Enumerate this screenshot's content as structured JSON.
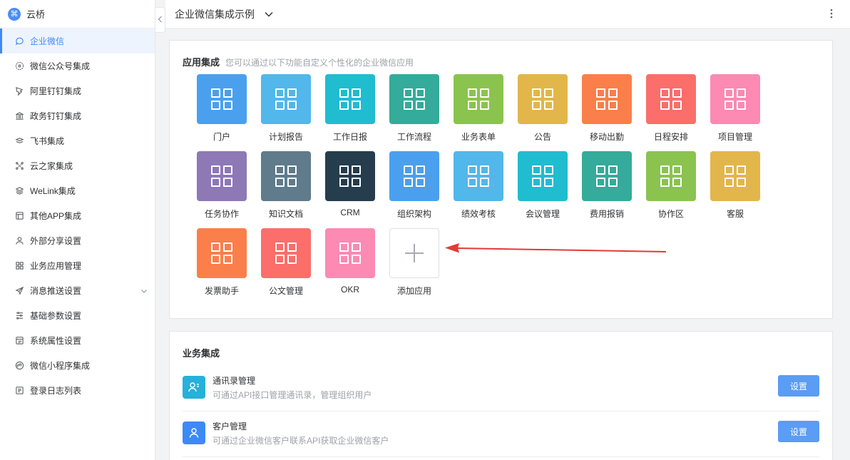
{
  "brand": {
    "name": "云桥"
  },
  "sidebar": {
    "items": [
      {
        "label": "企业微信",
        "icon": "chat-icon",
        "active": true
      },
      {
        "label": "微信公众号集成",
        "icon": "compass-icon"
      },
      {
        "label": "阿里钉钉集成",
        "icon": "dingtalk-icon"
      },
      {
        "label": "政务钉钉集成",
        "icon": "bank-icon"
      },
      {
        "label": "飞书集成",
        "icon": "feishu-icon"
      },
      {
        "label": "云之家集成",
        "icon": "network-icon"
      },
      {
        "label": "WeLink集成",
        "icon": "layers-icon"
      },
      {
        "label": "其他APP集成",
        "icon": "app-icon"
      },
      {
        "label": "外部分享设置",
        "icon": "user-icon"
      },
      {
        "label": "业务应用管理",
        "icon": "grid-icon"
      },
      {
        "label": "消息推送设置",
        "icon": "send-icon",
        "expandable": true
      },
      {
        "label": "基础参数设置",
        "icon": "sliders-icon"
      },
      {
        "label": "系统属性设置",
        "icon": "window-icon"
      },
      {
        "label": "微信小程序集成",
        "icon": "miniapp-icon"
      },
      {
        "label": "登录日志列表",
        "icon": "log-icon"
      }
    ]
  },
  "header": {
    "title": "企业微信集成示例"
  },
  "apps_section": {
    "title": "应用集成",
    "subtitle": "您可以通过以下功能自定义个性化的企业微信应用",
    "apps": [
      {
        "label": "门户",
        "color": "#4aa0ee"
      },
      {
        "label": "计划报告",
        "color": "#52b7ea"
      },
      {
        "label": "工作日报",
        "color": "#20bcd0"
      },
      {
        "label": "工作流程",
        "color": "#34ab9b"
      },
      {
        "label": "业务表单",
        "color": "#8bc34f"
      },
      {
        "label": "公告",
        "color": "#e3b64b"
      },
      {
        "label": "移动出勤",
        "color": "#fb7f4a"
      },
      {
        "label": "日程安排",
        "color": "#fb6e6a"
      },
      {
        "label": "项目管理",
        "color": "#fc8ab3"
      },
      {
        "label": "任务协作",
        "color": "#8e78b6"
      },
      {
        "label": "知识文档",
        "color": "#607b8b"
      },
      {
        "label": "CRM",
        "color": "#263d4d"
      },
      {
        "label": "组织架构",
        "color": "#4aa0ee"
      },
      {
        "label": "绩效考核",
        "color": "#52b7ea"
      },
      {
        "label": "会议管理",
        "color": "#20bcd0"
      },
      {
        "label": "费用报销",
        "color": "#34ab9b"
      },
      {
        "label": "协作区",
        "color": "#8bc34f"
      },
      {
        "label": "客服",
        "color": "#e3b64b"
      },
      {
        "label": "发票助手",
        "color": "#fb7f4a"
      },
      {
        "label": "公文管理",
        "color": "#fb6e6a"
      },
      {
        "label": "OKR",
        "color": "#fc8ab3"
      }
    ],
    "add_label": "添加应用"
  },
  "biz_section": {
    "title": "业务集成",
    "items": [
      {
        "name": "通讯录管理",
        "desc": "可通过API接口管理通讯录，管理组织用户",
        "button": "设置",
        "icon": "contacts-icon"
      },
      {
        "name": "客户管理",
        "desc": "可通过企业微信客户联系API获取企业微信客户",
        "button": "设置",
        "icon": "customer-icon"
      }
    ]
  }
}
